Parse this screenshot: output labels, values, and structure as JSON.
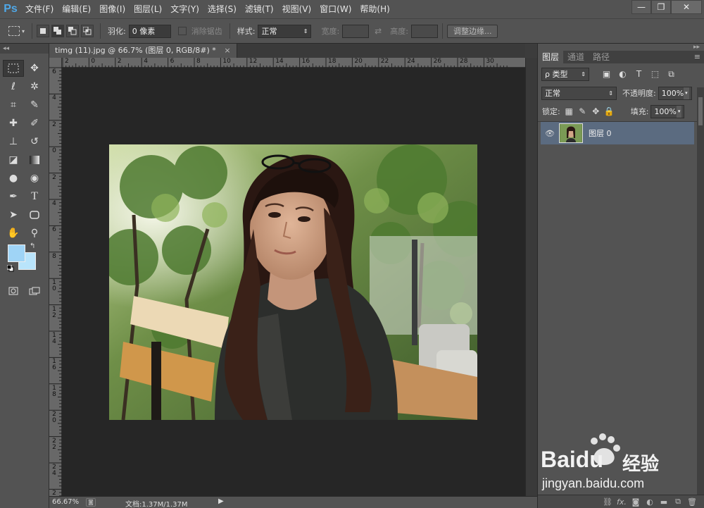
{
  "app": {
    "logo": "Ps"
  },
  "menu": [
    "文件(F)",
    "编辑(E)",
    "图像(I)",
    "图层(L)",
    "文字(Y)",
    "选择(S)",
    "滤镜(T)",
    "视图(V)",
    "窗口(W)",
    "帮助(H)"
  ],
  "window_controls": {
    "minimize": "—",
    "restore": "❐",
    "close": "✕"
  },
  "options": {
    "feather_label": "羽化:",
    "feather_value": "0 像素",
    "antialias_label": "消除锯齿",
    "style_label": "样式:",
    "style_value": "正常",
    "width_label": "宽度:",
    "height_label": "高度:",
    "refine_edge": "调整边缘..."
  },
  "document": {
    "tab_title": "timg (11).jpg @ 66.7% (图层 0, RGB/8#) *",
    "tab_close": "×",
    "ruler_top": [
      "2",
      "0",
      "2",
      "4",
      "6",
      "8",
      "10",
      "12",
      "14",
      "16",
      "18",
      "20",
      "22",
      "24",
      "26",
      "28",
      "30"
    ],
    "ruler_left": [
      "6",
      "4",
      "2",
      "0",
      "2",
      "4",
      "6",
      "8",
      "10",
      "12",
      "14",
      "16",
      "18",
      "20",
      "22",
      "24",
      "26"
    ]
  },
  "status": {
    "zoom": "66.67%",
    "doc_info": "文档:1.37M/1.37M"
  },
  "panel": {
    "tabs": [
      "图层",
      "通道",
      "路径"
    ],
    "filter_kind": "ρ 类型",
    "blend_mode": "正常",
    "opacity_label": "不透明度:",
    "opacity_value": "100%",
    "lock_label": "锁定:",
    "fill_label": "填充:",
    "fill_value": "100%",
    "layers": [
      {
        "name": "图层 0",
        "visible": true
      }
    ]
  },
  "watermark": {
    "brand": "Baidu",
    "brand_cn": "经验",
    "url": "jingyan.baidu.com"
  },
  "colors": {
    "foreground": "#9fd4f6",
    "background": "#b9e4fb",
    "selected_layer": "#5b6b80"
  }
}
